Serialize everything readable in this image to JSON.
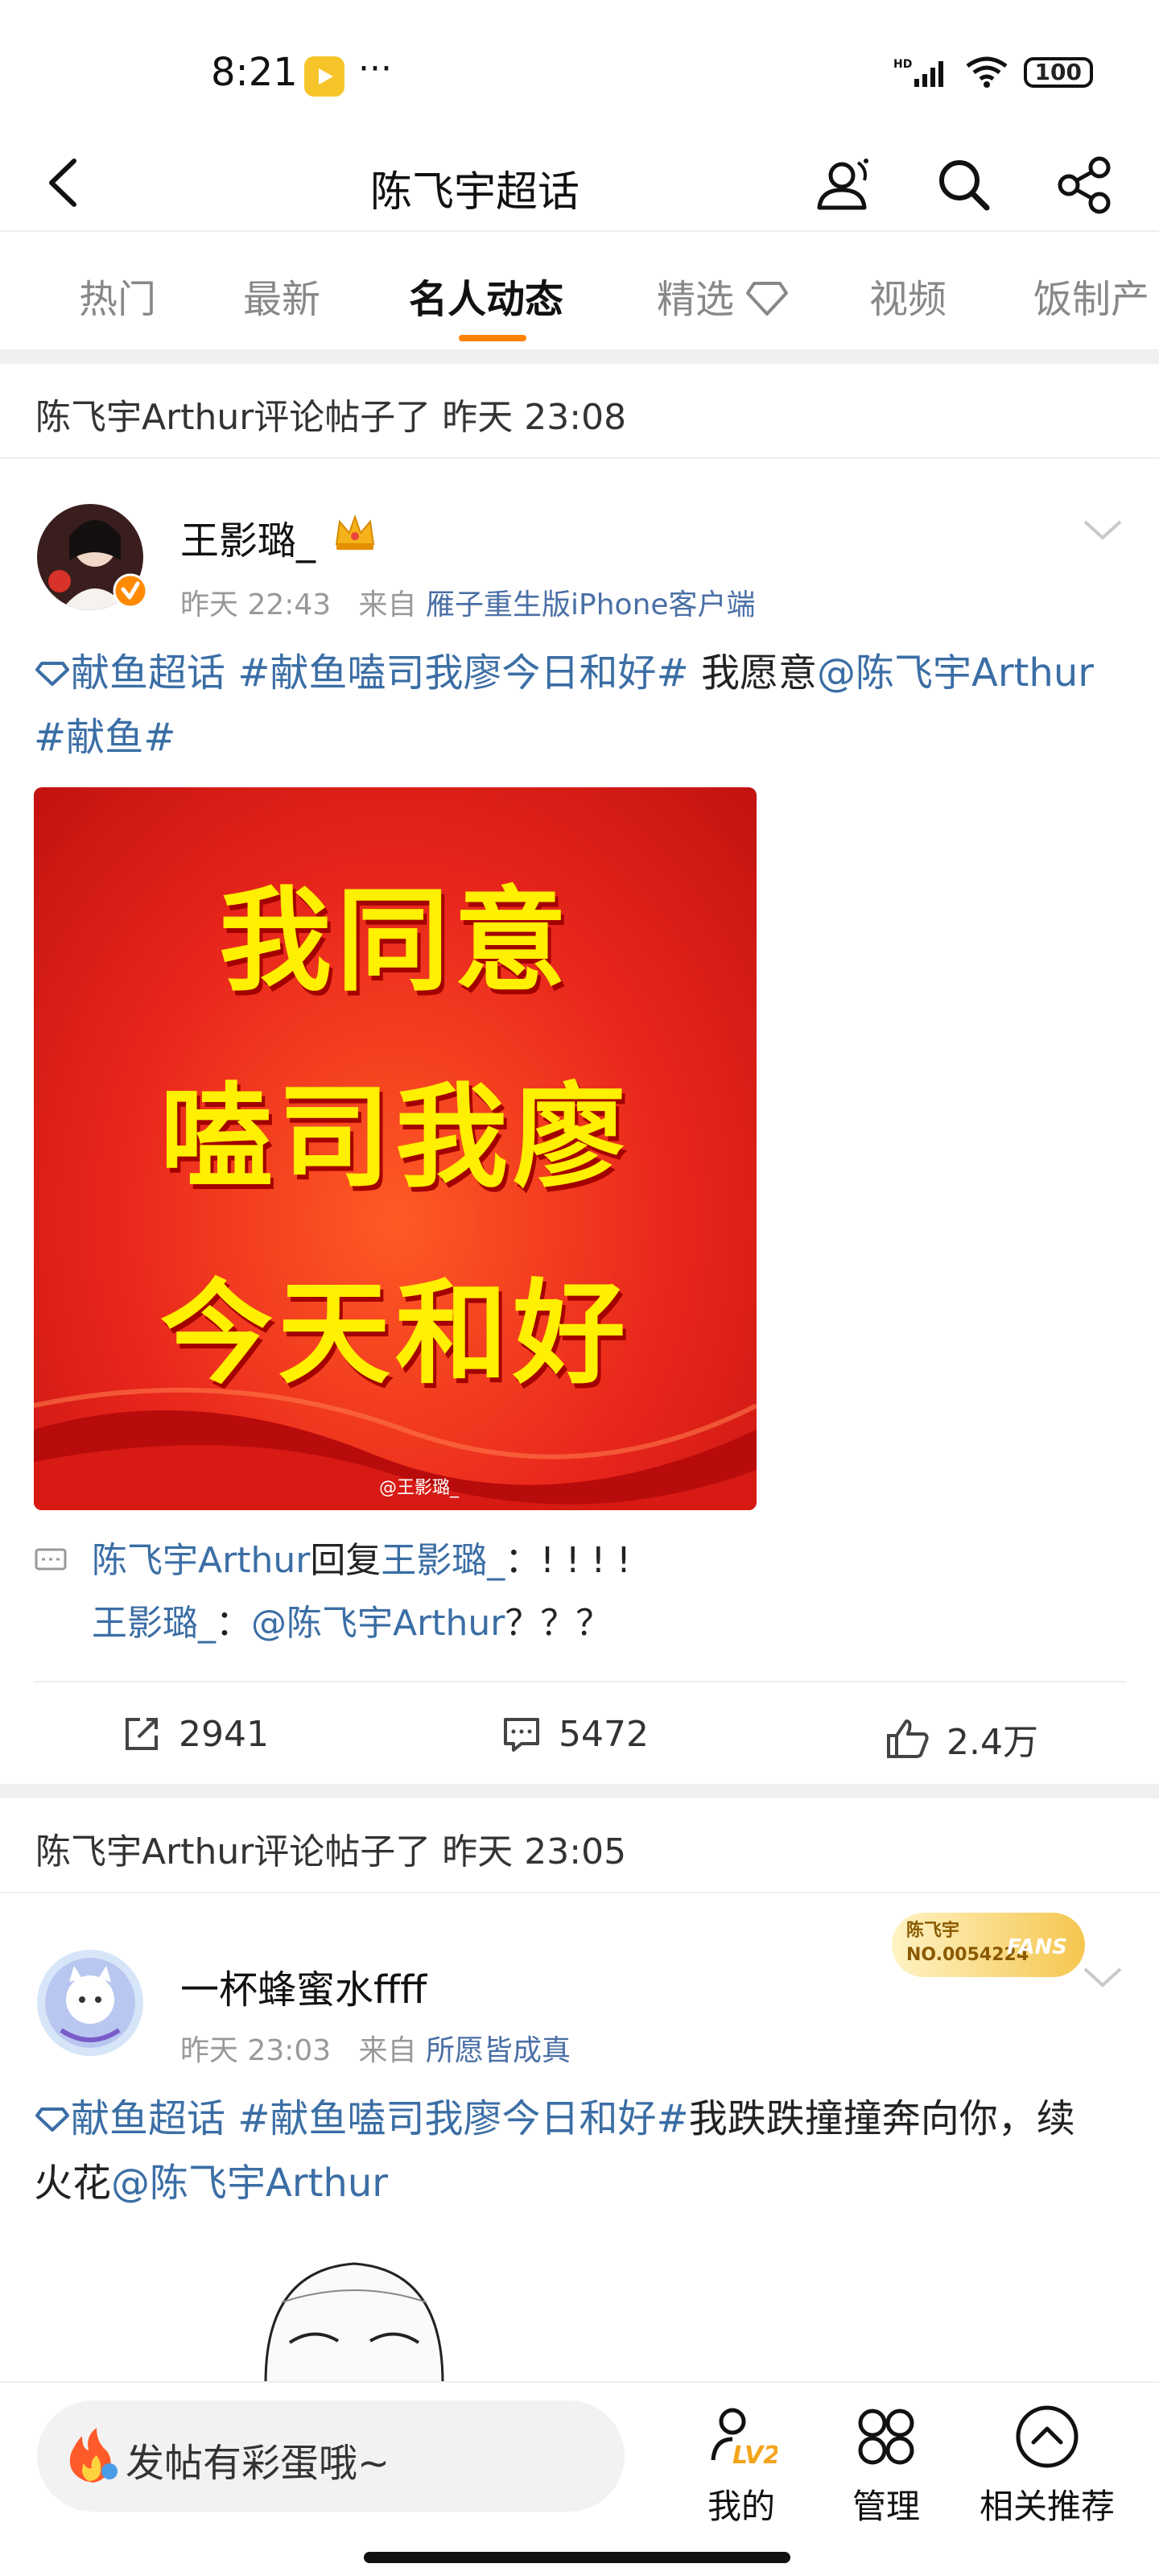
{
  "status": {
    "time": "8:21",
    "battery": "100"
  },
  "header": {
    "title": "陈飞宇超话"
  },
  "tabs": [
    "热门",
    "最新",
    "名人动态",
    "精选",
    "视频",
    "饭制产"
  ],
  "posts": [
    {
      "activity": "陈飞宇Arthur评论帖子了 昨天 23:08",
      "username": "王影璐_",
      "time": "昨天 22:43",
      "source_prefix": "来自",
      "source": "雁子重生版iPhone客户端",
      "text_tag1": "献鱼超话",
      "text_tag2": "#献鱼嗑司我廖今日和好#",
      "text_plain": " 我愿意",
      "text_mention": "@陈飞宇Arthur",
      "text_tag3": " #献鱼#",
      "image_lines": [
        "我同意",
        "嗑司我廖",
        "今天和好"
      ],
      "image_watermark": "@王影璐_",
      "reply1_user": "陈飞宇Arthur",
      "reply1_mid": "回复",
      "reply1_target": "王影璐_",
      "reply1_text": "：! ! ! !",
      "reply2_user": "王影璐_",
      "reply2_mid": "：",
      "reply2_mention": "@陈飞宇Arthur",
      "reply2_text": "？？？",
      "reposts": "2941",
      "comments": "5472",
      "likes": "2.4万"
    },
    {
      "activity": "陈飞宇Arthur评论帖子了 昨天 23:05",
      "username": "一杯蜂蜜水ffff",
      "time": "昨天 23:03",
      "source_prefix": "来自",
      "source": "所愿皆成真",
      "badge_name": "陈飞宇",
      "badge_no": "NO.0054224",
      "badge_word": "FANS",
      "text_tag1": "献鱼超话",
      "text_tag2": "#献鱼嗑司我廖今日和好#",
      "text_plain": "我跌跌撞撞奔向你，续火花",
      "text_mention": "@陈飞宇Arthur"
    }
  ],
  "bottom": {
    "compose_placeholder": "发帖有彩蛋哦~",
    "nav": [
      "我的",
      "管理",
      "相关推荐"
    ],
    "level": "LV2"
  }
}
